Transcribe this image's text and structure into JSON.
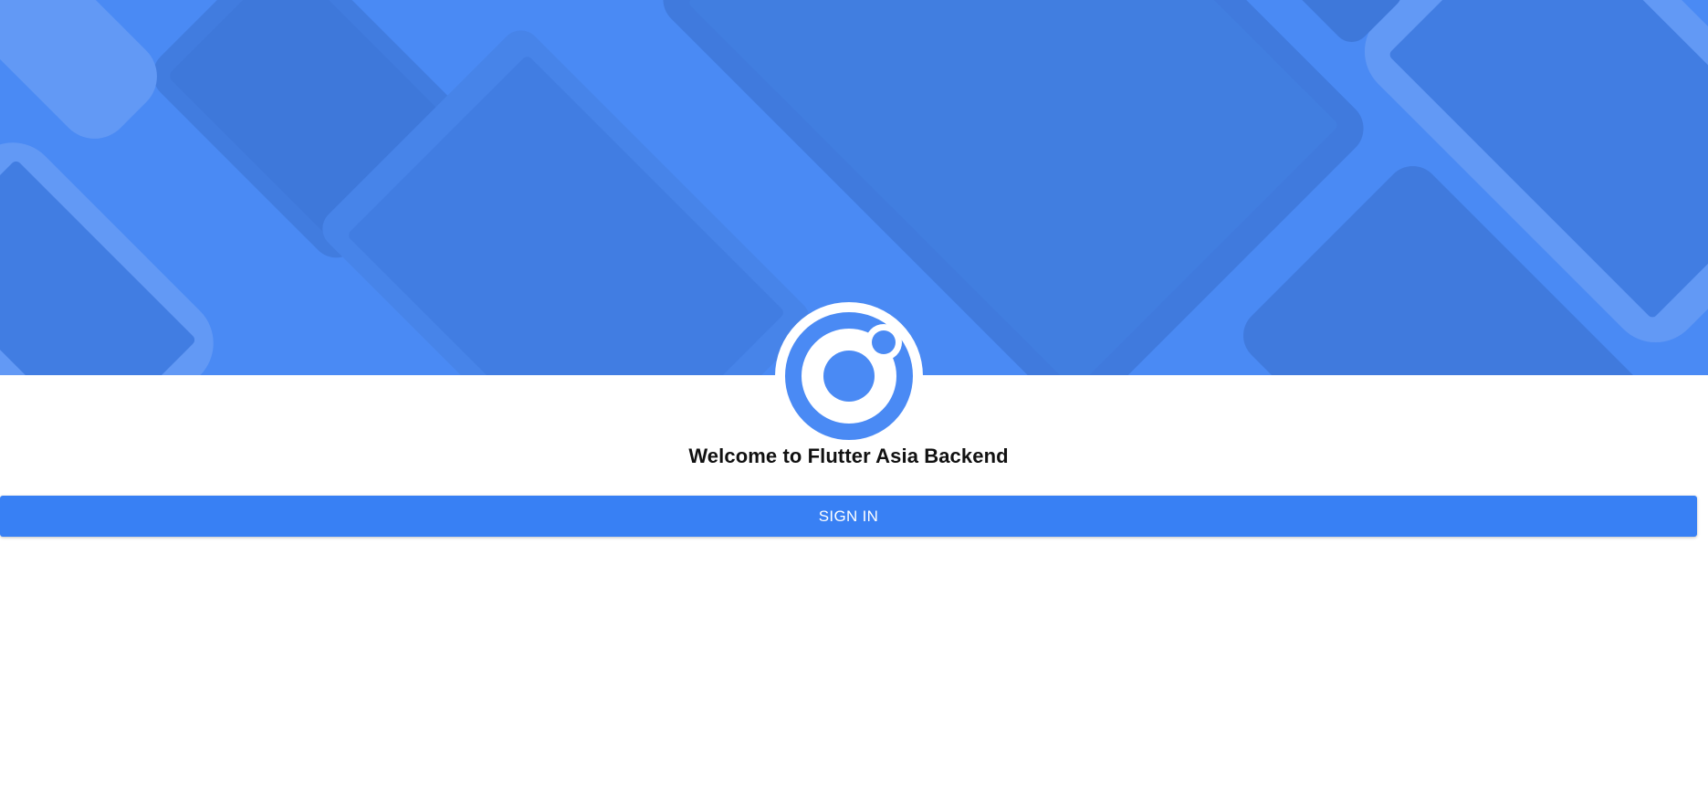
{
  "hero": {
    "background_color": "#4a8af4",
    "pattern": "rotated-device-silhouettes"
  },
  "logo": {
    "icon": "ionic-logo-icon",
    "color": "#4a8af4"
  },
  "welcome": {
    "title": "Welcome to Flutter Asia Backend"
  },
  "actions": {
    "sign_in_label": "SIGN IN",
    "button_color": "#3880f4"
  }
}
